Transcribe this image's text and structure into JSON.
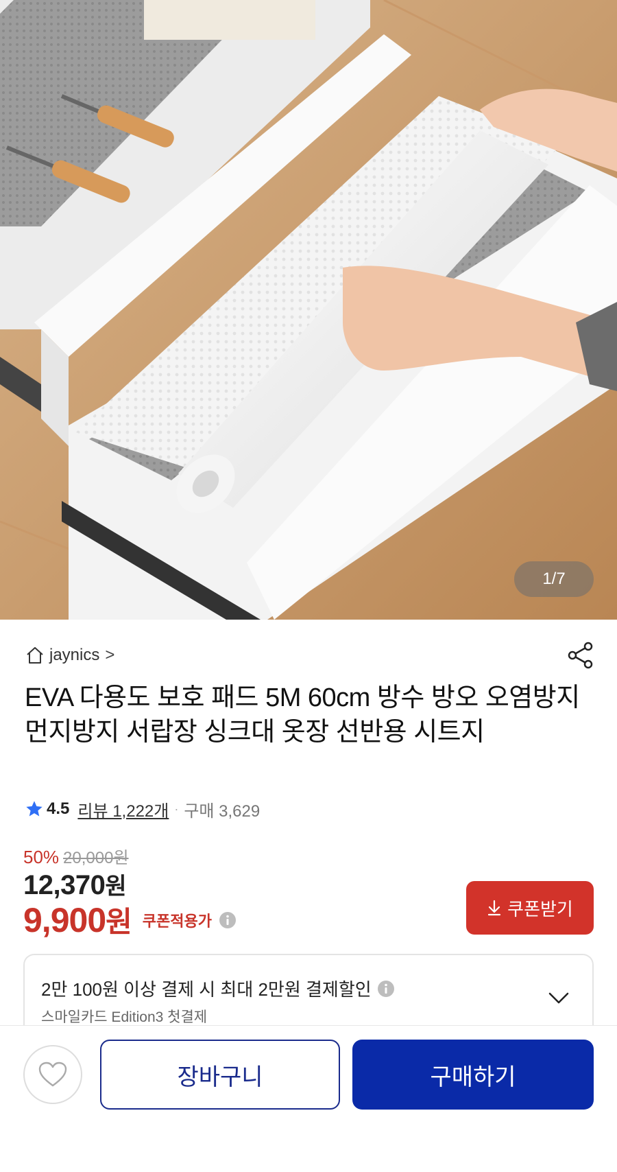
{
  "gallery": {
    "counter": "1/7"
  },
  "store": {
    "name": "jaynics",
    "chevron": ">"
  },
  "product": {
    "title": "EVA 다용도 보호 패드 5M 60cm 방수 방오 오염방지 먼지방지 서랍장 싱크대 옷장 선반용 시트지",
    "rating": "4.5",
    "review_label": "리뷰 1,222개",
    "separator": "·",
    "purchase_label": "구매 3,629"
  },
  "price": {
    "discount_rate": "50%",
    "original_price": "20,000원",
    "sale_amount": "12,370",
    "sale_unit": "원",
    "coupon_amount": "9,900",
    "coupon_unit": "원",
    "coupon_label": "쿠폰적용가"
  },
  "coupon_button": {
    "label": "쿠폰받기",
    "icon": "download-arrow-icon"
  },
  "card_promo": {
    "main": "2만 100원 이상 결제 시 최대 2만원 결제할인",
    "sub": "스마일카드 Edition3 첫결제"
  },
  "bottom_bar": {
    "cart_label": "장바구니",
    "buy_label": "구매하기"
  },
  "colors": {
    "accent_red": "#d2332a",
    "brand_blue": "#0a2aa8",
    "rating_star": "#2f6ff5"
  }
}
